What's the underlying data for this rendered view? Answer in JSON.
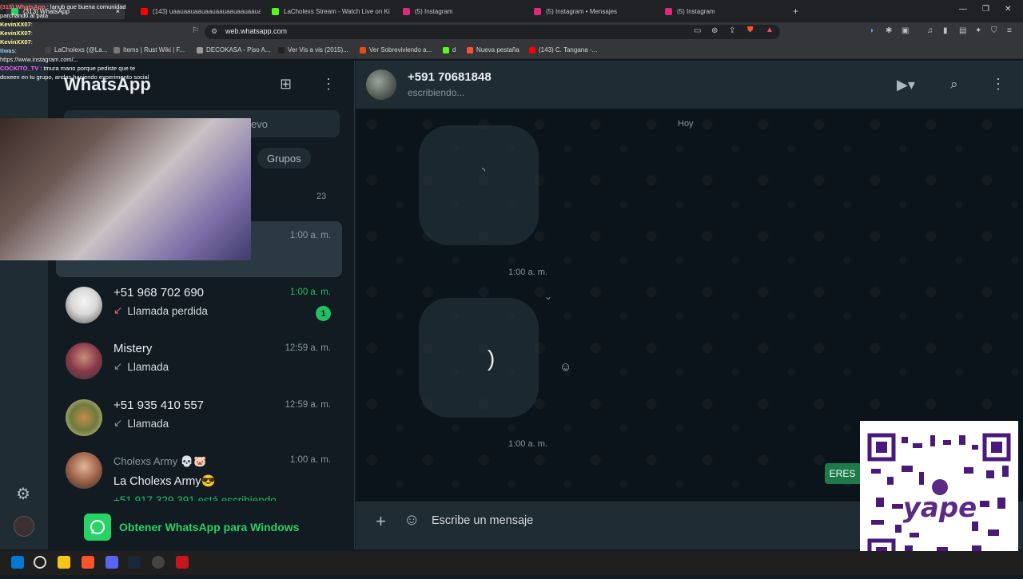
{
  "browser": {
    "tabs": [
      {
        "label": "(313) WhatsApp",
        "active": true,
        "color": "#25d366"
      },
      {
        "label": "(143) uaauaauaauaauaauaauaauaauaa",
        "color": "#ff0000"
      },
      {
        "label": "LaCholexs Stream - Watch Live on Ki",
        "color": "#53fc18"
      },
      {
        "label": "(5) Instagram",
        "color": "#dd2a7b"
      },
      {
        "label": "(5) Instagram • Mensajes",
        "color": "#dd2a7b"
      },
      {
        "label": "(5) Instagram",
        "color": "#dd2a7b"
      }
    ],
    "new_tab": "+",
    "url": "web.whatsapp.com",
    "bookmarks": [
      {
        "label": "LaCholexs (@La...",
        "color": "#444"
      },
      {
        "label": "Items | Rust Wiki | F...",
        "color": "#777"
      },
      {
        "label": "DECOKASA - Piso A...",
        "color": "#999"
      },
      {
        "label": "Ver Vis a vis (2015)...",
        "color": "#333"
      },
      {
        "label": "Ver Sobreviviendo a...",
        "color": "#e65100"
      },
      {
        "label": "d",
        "color": "#53fc18"
      },
      {
        "label": "Nueva pestaña",
        "color": "#fb542b"
      },
      {
        "label": "(143) C. Tangana -...",
        "color": "#ff0000"
      }
    ]
  },
  "whatsapp": {
    "app_title": "WhatsApp",
    "search_placeholder_visible": "evo",
    "filters": {
      "groups": "Grupos"
    },
    "archived_count": "23",
    "chats": [
      {
        "name": "",
        "subtitle": "",
        "time": "1:00 a. m.",
        "selected": true
      },
      {
        "name": "+51 968 702 690",
        "subtitle": "Llamada perdida",
        "time": "1:00 a. m.",
        "unread": "1",
        "missed": true
      },
      {
        "name": "Mistery",
        "subtitle": "Llamada",
        "time": "12:59 a. m."
      },
      {
        "name": "+51 935 410 557",
        "subtitle": "Llamada",
        "time": "12:59 a. m."
      },
      {
        "name": "Cholexs Army 💀🐷",
        "subtitle": "La Cholexs Army😎",
        "time": "1:00 a. m.",
        "typing": "+51 917 329 391 está escribiendo"
      }
    ],
    "get_app_label": "Obtener WhatsApp para Windows",
    "conversation": {
      "contact": "+591 70681848",
      "status": "escribiendo...",
      "day_label": "Hoy",
      "messages": [
        {
          "time": "1:00 a. m."
        },
        {
          "time": "1:00 a. m."
        }
      ],
      "composer_placeholder": "Escribe un mensaje"
    }
  },
  "overlay": {
    "chat_lines": [
      {
        "user": "(313) WhatsApp",
        "text": ": lanub que buena comunidad"
      },
      {
        "user": "",
        "text": "parchando al pata"
      },
      {
        "user": "KevinXX07",
        "text": ":"
      },
      {
        "user": "KevinXX07",
        "text": ":"
      },
      {
        "user": "KevinXX07",
        "text": ":"
      },
      {
        "user": "tiwas",
        "text": ":"
      },
      {
        "user": "",
        "text": "https://www.instagram.com/..."
      },
      {
        "user": "COCKITO_TV",
        "text": ": tmura mano porque pediste que te"
      },
      {
        "user": "",
        "text": "doxeen en tu grupo, andas haciendo experimento social"
      }
    ],
    "side_label": "ERES",
    "qr_brand": "yape"
  }
}
